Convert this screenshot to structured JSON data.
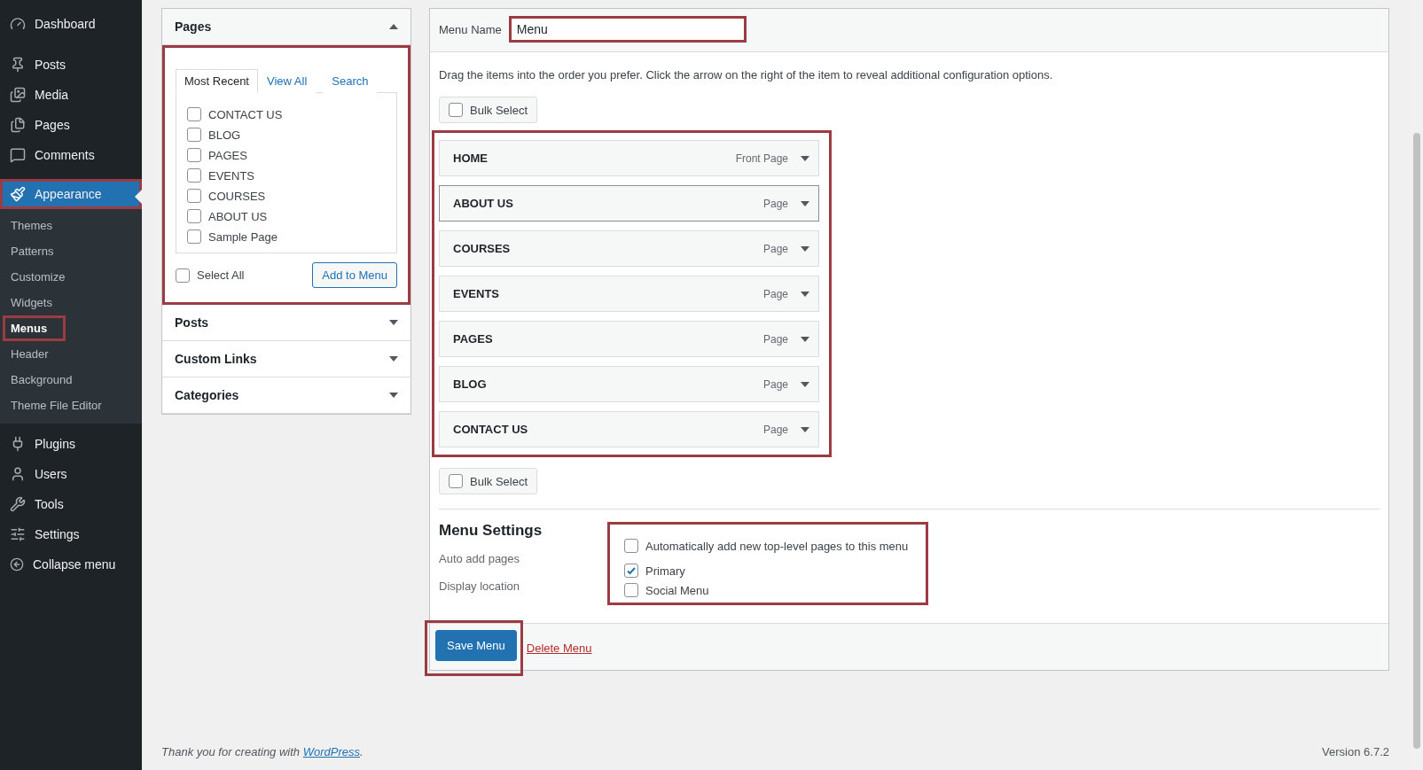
{
  "sidebar": {
    "items": [
      {
        "label": "Dashboard",
        "selected": false,
        "highlighted": false
      },
      {
        "label": "Posts",
        "selected": false,
        "highlighted": false
      },
      {
        "label": "Media",
        "selected": false,
        "highlighted": false
      },
      {
        "label": "Pages",
        "selected": false,
        "highlighted": false
      },
      {
        "label": "Comments",
        "selected": false,
        "highlighted": false
      },
      {
        "label": "Appearance",
        "selected": true,
        "highlighted": true,
        "children": [
          {
            "label": "Themes",
            "selected": false,
            "highlighted": false
          },
          {
            "label": "Patterns",
            "selected": false,
            "highlighted": false
          },
          {
            "label": "Customize",
            "selected": false,
            "highlighted": false
          },
          {
            "label": "Widgets",
            "selected": false,
            "highlighted": false
          },
          {
            "label": "Menus",
            "selected": true,
            "highlighted": true
          },
          {
            "label": "Header",
            "selected": false,
            "highlighted": false
          },
          {
            "label": "Background",
            "selected": false,
            "highlighted": false
          },
          {
            "label": "Theme File Editor",
            "selected": false,
            "highlighted": false
          }
        ]
      },
      {
        "label": "Plugins",
        "selected": false,
        "highlighted": false
      },
      {
        "label": "Users",
        "selected": false,
        "highlighted": false
      },
      {
        "label": "Tools",
        "selected": false,
        "highlighted": false
      },
      {
        "label": "Settings",
        "selected": false,
        "highlighted": false
      },
      {
        "label": "Collapse menu",
        "selected": false,
        "highlighted": false
      }
    ]
  },
  "left_panel": {
    "sections": [
      {
        "title": "Pages",
        "expanded": true,
        "highlighted": true,
        "tabs": [
          {
            "label": "Most Recent",
            "selected": true
          },
          {
            "label": "View All",
            "selected": false
          },
          {
            "label": "Search",
            "selected": false
          }
        ],
        "items": [
          {
            "label": "CONTACT US",
            "checked": false
          },
          {
            "label": "BLOG",
            "checked": false
          },
          {
            "label": "PAGES",
            "checked": false
          },
          {
            "label": "EVENTS",
            "checked": false
          },
          {
            "label": "COURSES",
            "checked": false
          },
          {
            "label": "ABOUT US",
            "checked": false
          },
          {
            "label": "Sample Page",
            "checked": false
          }
        ],
        "select_all": {
          "label": "Select All",
          "checked": false
        },
        "add_button": "Add to Menu"
      },
      {
        "title": "Posts",
        "expanded": false
      },
      {
        "title": "Custom Links",
        "expanded": false
      },
      {
        "title": "Categories",
        "expanded": false
      }
    ]
  },
  "menu_editor": {
    "name_label": "Menu Name",
    "name_value": "Menu",
    "name_highlighted": true,
    "instructions": "Drag the items into the order you prefer. Click the arrow on the right of the item to reveal additional configuration options.",
    "bulk_select_top": {
      "label": "Bulk Select",
      "checked": false
    },
    "menu_items": {
      "highlighted": true,
      "items": [
        {
          "title": "HOME",
          "type": "Front Page",
          "selected": false
        },
        {
          "title": "ABOUT US",
          "type": "Page",
          "selected": true
        },
        {
          "title": "COURSES",
          "type": "Page",
          "selected": false
        },
        {
          "title": "EVENTS",
          "type": "Page",
          "selected": false
        },
        {
          "title": "PAGES",
          "type": "Page",
          "selected": false
        },
        {
          "title": "BLOG",
          "type": "Page",
          "selected": false
        },
        {
          "title": "CONTACT US",
          "type": "Page",
          "selected": false
        }
      ]
    },
    "bulk_select_bottom": {
      "label": "Bulk Select",
      "checked": false
    },
    "settings": {
      "title": "Menu Settings",
      "highlighted": true,
      "rows": [
        {
          "label": "Auto add pages",
          "options": [
            {
              "label": "Automatically add new top-level pages to this menu",
              "checked": false
            }
          ]
        },
        {
          "label": "Display location",
          "options": [
            {
              "label": "Primary",
              "checked": true
            },
            {
              "label": "Social Menu",
              "checked": false
            }
          ]
        }
      ]
    },
    "save_button": {
      "label": "Save Menu",
      "highlighted": true
    },
    "delete_link": "Delete Menu"
  },
  "footer": {
    "credit": {
      "text": "Thank you for creating with ",
      "link": "WordPress",
      "end": "."
    },
    "version": "Version 6.7.2"
  }
}
